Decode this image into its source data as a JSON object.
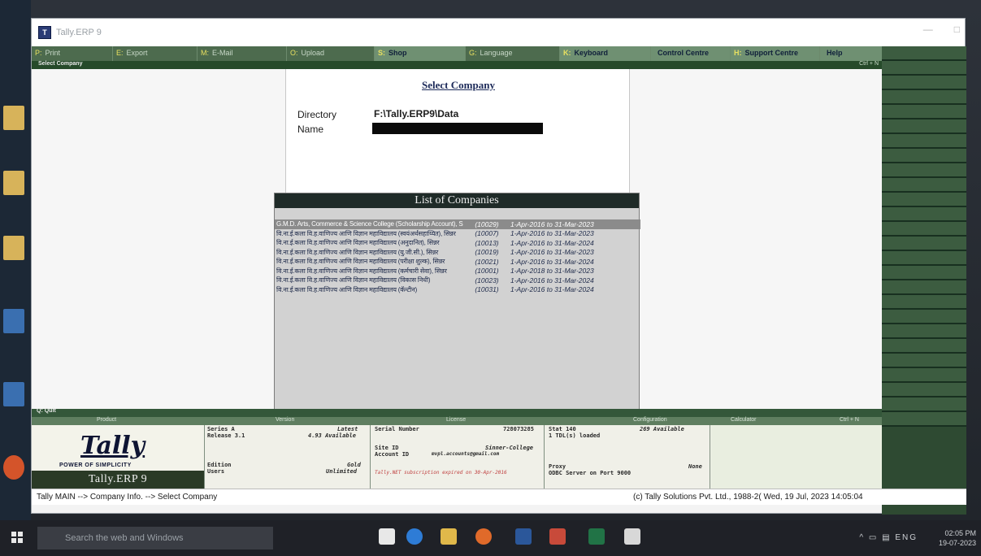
{
  "window": {
    "title": "Tally.ERP 9"
  },
  "topbar": {
    "buttons": [
      {
        "key": "P:",
        "label": "Print",
        "bold": false
      },
      {
        "key": "E:",
        "label": "Export",
        "bold": false
      },
      {
        "key": "M:",
        "label": "E-Mail",
        "bold": false
      },
      {
        "key": "O:",
        "label": "Upload",
        "bold": false
      },
      {
        "key": "S:",
        "label": "Shop",
        "bold": true
      },
      {
        "key": "G:",
        "label": "Language",
        "bold": false
      },
      {
        "key": "K:",
        "label": "Keyboard",
        "bold": true
      },
      {
        "key": "",
        "label": "Control Centre",
        "bold": true
      },
      {
        "key": "H:",
        "label": "Support Centre",
        "bold": true
      },
      {
        "key": "",
        "label": "Help",
        "bold": true
      }
    ],
    "subtitle": "Select Company",
    "shortcut": "Ctrl + N"
  },
  "select_company": {
    "title": "Select Company",
    "directory_label": "Directory",
    "directory_value": "F:\\Tally.ERP9\\Data",
    "name_label": "Name"
  },
  "list_of_companies": {
    "title": "List of Companies",
    "rows": [
      {
        "name": "G.M.D. Arts, Commerce & Science College (Scholarship Account), Sinnar",
        "code": "(10029)",
        "period": "1-Apr-2016 to 31-Mar-2023",
        "selected": true
      },
      {
        "name": "वि.ना.ई.कला वि.ह.वाणिज्य आणि विज्ञान महाविद्यालय (स्वयंअर्थसहाय्यित), सिन्नर",
        "code": "(10007)",
        "period": "1-Apr-2016 to 31-Mar-2023",
        "selected": false
      },
      {
        "name": "वि.ना.ई.कला वि.ह.वाणिज्य आणि विज्ञान महाविद्यालय (अनुदानित), सिन्नर",
        "code": "(10013)",
        "period": "1-Apr-2016 to 31-Mar-2024",
        "selected": false
      },
      {
        "name": "वि.ना.ई.कला वि.ह.वाणिज्य आणि विज्ञान महाविद्यालय (यु.जी.सी.), सिन्नर",
        "code": "(10019)",
        "period": "1-Apr-2016 to 31-Mar-2023",
        "selected": false
      },
      {
        "name": "वि.ना.ई.कला वि.ह.वाणिज्य आणि विज्ञान महाविद्यालय (परीक्षा शुल्क), सिन्नर",
        "code": "(10021)",
        "period": "1-Apr-2016 to 31-Mar-2024",
        "selected": false
      },
      {
        "name": "वि.ना.ई.कला वि.ह.वाणिज्य आणि विज्ञान महाविद्यालय (कर्मचारी सेवा), सिन्नर",
        "code": "(10001)",
        "period": "1-Apr-2018 to 31-Mar-2023",
        "selected": false
      },
      {
        "name": "वि.ना.ई.कला वि.ह.वाणिज्य आणि विज्ञान महाविद्यालय (विकास निधी)",
        "code": "(10023)",
        "period": "1-Apr-2016 to 31-Mar-2024",
        "selected": false
      },
      {
        "name": "वि.ना.ई.कला वि.ह.वाणिज्य आणि विज्ञान महाविद्यालय (कॅन्टीन)",
        "code": "(10031)",
        "period": "1-Apr-2016 to 31-Mar-2024",
        "selected": false
      }
    ]
  },
  "quit": {
    "label": "Quit",
    "key": "Q:"
  },
  "info": {
    "headers": {
      "product": "Product",
      "version": "Version",
      "license": "License",
      "configuration": "Configuration",
      "calculator": "Calculator",
      "shortcut": "Ctrl + N"
    },
    "logo": {
      "script": "Tally",
      "tagline": "POWER OF SIMPLICITY",
      "product": "Tally.ERP 9"
    },
    "version": {
      "series": "Series A",
      "release": "Release 3.1",
      "latest": "Latest",
      "available": "4.93 Available",
      "edition_label": "Edition",
      "edition_value": "Gold",
      "users_label": "Users",
      "users_value": "Unlimited"
    },
    "license": {
      "serial_label": "Serial Number",
      "serial_value": "728073285",
      "site_label": "Site ID",
      "site_value": "Sinner-College",
      "account_label": "Account ID",
      "account_value": "mvpl.accounts@gmail.com",
      "expiry": "Tally.NET subscription expired on 30-Apr-2016"
    },
    "config": {
      "stat": "Stat 140",
      "available": "269 Available",
      "tdl": "1 TDL(s) loaded",
      "proxy_label": "Proxy",
      "proxy_value": "None",
      "odbc": "ODBC Server on Port 9000"
    }
  },
  "statusbar": {
    "breadcrumb": "Tally MAIN --> Company Info. --> Select Company",
    "copyright": "(c) Tally Solutions Pvt. Ltd., 1988-2( Wed, 19 Jul, 2023 14:05:04"
  },
  "taskbar": {
    "search_placeholder": "Search the web and Windows",
    "lang": "ENG",
    "time": "02:05 PM",
    "date": "19-07-2023"
  }
}
